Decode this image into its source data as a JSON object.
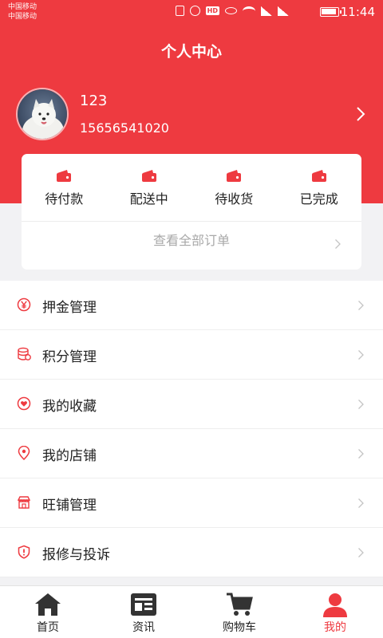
{
  "status_bar": {
    "carrier_1": "中国移动",
    "carrier_2": "中国移动",
    "time": "11:44"
  },
  "header": {
    "title": "个人中心"
  },
  "profile": {
    "username": "123",
    "phone": "15656541020",
    "avatar": "samoyed-dog-photo"
  },
  "orders": {
    "items": [
      {
        "label": "待付款",
        "icon": "wallet-icon"
      },
      {
        "label": "配送中",
        "icon": "wallet-icon"
      },
      {
        "label": "待收货",
        "icon": "wallet-icon"
      },
      {
        "label": "已完成",
        "icon": "wallet-icon"
      }
    ],
    "view_all": "查看全部订单"
  },
  "menu": [
    {
      "label": "押金管理",
      "icon": "yen-icon"
    },
    {
      "label": "积分管理",
      "icon": "coins-icon"
    },
    {
      "label": "我的收藏",
      "icon": "heart-icon"
    },
    {
      "label": "我的店铺",
      "icon": "location-pin-icon"
    },
    {
      "label": "旺铺管理",
      "icon": "store-icon"
    },
    {
      "label": "报修与投诉",
      "icon": "shield-alert-icon"
    }
  ],
  "tabbar": [
    {
      "label": "首页",
      "icon": "home-icon",
      "active": false
    },
    {
      "label": "资讯",
      "icon": "news-icon",
      "active": false
    },
    {
      "label": "购物车",
      "icon": "cart-icon",
      "active": false
    },
    {
      "label": "我的",
      "icon": "user-icon",
      "active": true
    }
  ],
  "colors": {
    "accent": "#ee3a40",
    "background": "#f2f2f4",
    "text": "#222222",
    "muted": "#a9a9a9"
  }
}
